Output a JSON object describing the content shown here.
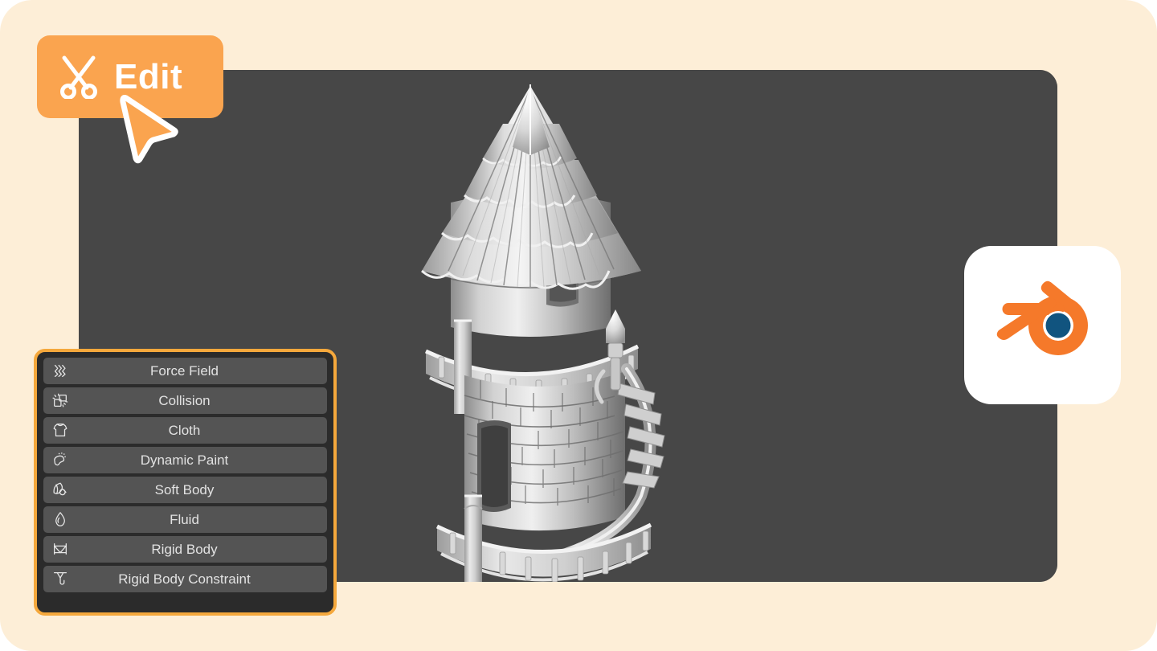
{
  "page": {
    "background_color": "#fdeed7"
  },
  "badge": {
    "label": "Edit",
    "icon": "scissors-icon",
    "background_color": "#faa44f",
    "text_color": "#ffffff"
  },
  "cursor": {
    "icon": "cursor-arrow-icon",
    "fill_color": "#faa44f",
    "outline_color": "#ffffff"
  },
  "viewport": {
    "background_color": "#474747",
    "model_name": "wizard-tower-model"
  },
  "physics_panel": {
    "border_color": "#f5a83c",
    "background_color": "#2b2b2b",
    "item_background_color": "#545454",
    "item_text_color": "#e2e2e2",
    "items": [
      {
        "label": "Force Field",
        "icon": "force-field-icon"
      },
      {
        "label": "Collision",
        "icon": "collision-icon"
      },
      {
        "label": "Cloth",
        "icon": "cloth-icon"
      },
      {
        "label": "Dynamic Paint",
        "icon": "dynamic-paint-icon"
      },
      {
        "label": "Soft Body",
        "icon": "soft-body-icon"
      },
      {
        "label": "Fluid",
        "icon": "fluid-icon"
      },
      {
        "label": "Rigid Body",
        "icon": "rigid-body-icon"
      },
      {
        "label": "Rigid Body Constraint",
        "icon": "rigid-body-constraint-icon"
      }
    ]
  },
  "blender_logo": {
    "name": "blender-logo",
    "card_color": "#ffffff",
    "accent_color": "#f5792a",
    "eye_color": "#11547f"
  }
}
